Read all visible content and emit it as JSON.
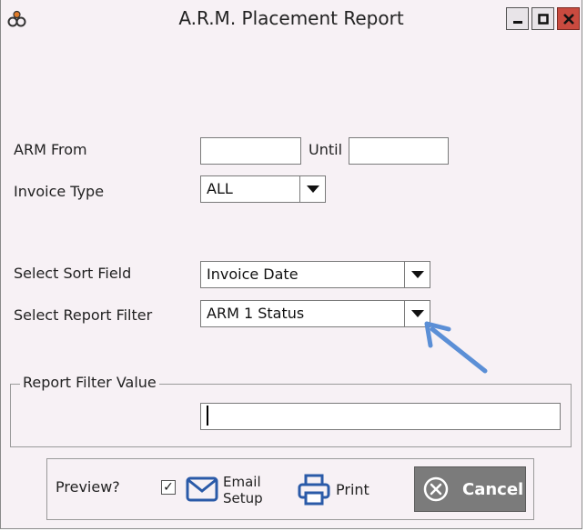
{
  "window": {
    "title": "A.R.M. Placement Report",
    "icon": "gears-icon",
    "controls": [
      "minimize-icon",
      "maximize-icon",
      "close-icon"
    ]
  },
  "form": {
    "arm_from_label": "ARM From",
    "arm_from_value": "",
    "until_label": "Until",
    "until_value": "",
    "invoice_type_label": "Invoice Type",
    "invoice_type_value": "ALL",
    "sort_field_label": "Select Sort Field",
    "sort_field_value": "Invoice Date",
    "report_filter_label": "Select Report Filter",
    "report_filter_value": "ARM 1 Status"
  },
  "filter_group": {
    "legend": "Report Filter Value",
    "value": ""
  },
  "footer": {
    "preview_label": "Preview?",
    "preview_checked": true,
    "preview_mark": "✓",
    "email_line1": "Email",
    "email_line2": "Setup",
    "print_label": "Print",
    "cancel_label": "Cancel"
  },
  "colors": {
    "window_bg": "#f7f1f5",
    "close_button": "#c94a3f",
    "annotation_arrow": "#5b8fd6",
    "cancel_button": "#7b7b7b",
    "icon_blue": "#2a5aa8"
  }
}
